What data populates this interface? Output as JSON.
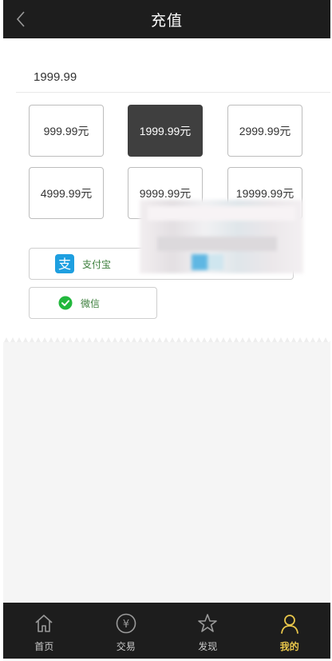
{
  "header": {
    "title": "充值",
    "back_icon": "chevron-left-icon"
  },
  "amount_input": {
    "value": "1999.99"
  },
  "amount_options": [
    {
      "label": "999.99元",
      "selected": false
    },
    {
      "label": "1999.99元",
      "selected": true
    },
    {
      "label": "2999.99元",
      "selected": false
    },
    {
      "label": "4999.99元",
      "selected": false
    },
    {
      "label": "9999.99元",
      "selected": false
    },
    {
      "label": "19999.99元",
      "selected": false
    }
  ],
  "payment_methods": [
    {
      "label": "支付宝",
      "icon": "alipay-icon",
      "color": "#1e9fe0"
    },
    {
      "label": "微信",
      "icon": "wechat-icon",
      "color": "#22b83d"
    }
  ],
  "tabbar": {
    "items": [
      {
        "label": "首页",
        "icon": "home-icon",
        "active": false
      },
      {
        "label": "交易",
        "icon": "yen-icon",
        "active": false
      },
      {
        "label": "发现",
        "icon": "star-icon",
        "active": false
      },
      {
        "label": "我的",
        "icon": "user-icon",
        "active": true
      }
    ],
    "active_color": "#e7c54a"
  }
}
